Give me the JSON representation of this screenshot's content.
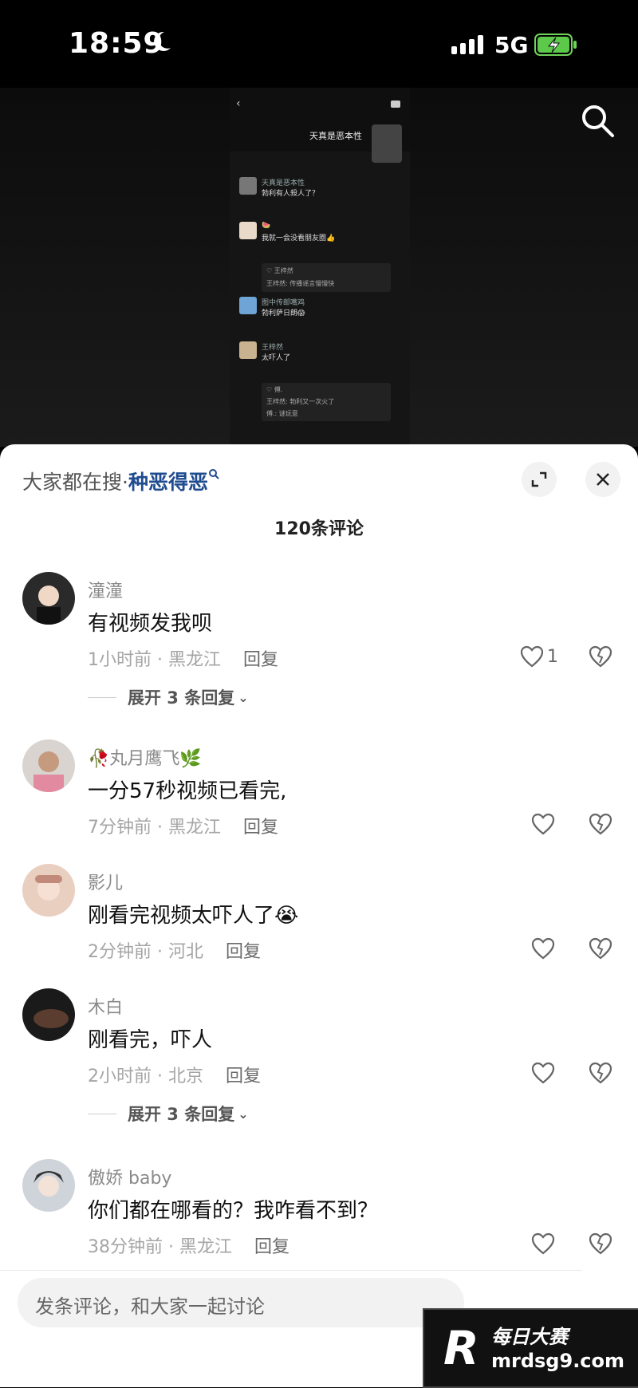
{
  "status_bar": {
    "time": "18:59",
    "network": "5G"
  },
  "video_preview": {
    "title": "天真是恶本性",
    "rows": [
      {
        "name": "天真是恶本性",
        "text": "勃利有人殺人了？"
      },
      {
        "name": "🍉",
        "text": "我就一会没看朋友圈👍"
      },
      {
        "name": "图中传邮嘴鸡",
        "text": "勃利萨日朗😱"
      },
      {
        "name": "王梓然",
        "text": "太吓人了"
      }
    ],
    "reply1": [
      "♡ 王梓然",
      "王梓然: 传播谣言慢慢快"
    ],
    "reply2": [
      "♡ 傅.",
      "王梓然: 勃利又一次火了",
      "傅.: 谜玩意"
    ]
  },
  "sheet": {
    "hot_label": "大家都在搜·",
    "hot_term": "种恶得恶",
    "comment_count": "120条评论"
  },
  "comments": [
    {
      "name": "潼潼",
      "text": "有视频发我呗",
      "time": "1小时前 · 黑龙江",
      "reply": "回复",
      "likes": "1",
      "expand": "展开 3 条回复"
    },
    {
      "name": "丸月鹰飞",
      "text": "一分57秒视频已看完,",
      "time": "7分钟前 · 黑龙江",
      "reply": "回复",
      "likes": ""
    },
    {
      "name": "影儿",
      "text": "刚看完视频太吓人了😭",
      "time": "2分钟前 · 河北",
      "reply": "回复",
      "likes": ""
    },
    {
      "name": "木白",
      "text": "刚看完，吓人",
      "time": "2小时前 · 北京",
      "reply": "回复",
      "likes": "",
      "expand": "展开 3 条回复"
    },
    {
      "name": "傲娇 baby",
      "text": "你们都在哪看的？我咋看不到？",
      "time": "38分钟前 · 黑龙江",
      "reply": "回复",
      "likes": ""
    }
  ],
  "input": {
    "placeholder": "发条评论，和大家一起讨论"
  },
  "watermark": {
    "logo": "R",
    "site_cn": "每日大赛",
    "url": "mrdsg9.com"
  }
}
